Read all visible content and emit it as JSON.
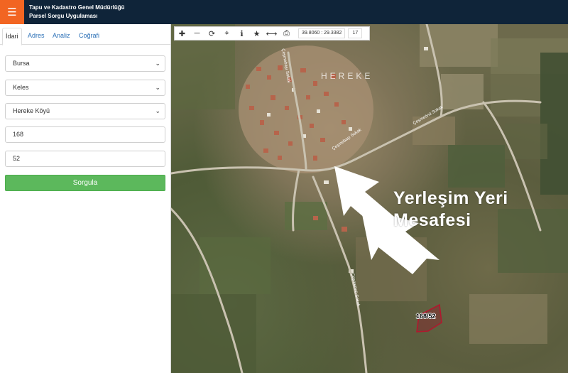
{
  "header": {
    "menu_icon": "hamburger-icon",
    "title_line1": "Tapu ve Kadastro Genel Müdürlüğü",
    "title_line2": "Parsel Sorgu Uygulaması",
    "background": "#0f2439",
    "accent": "#f26522"
  },
  "sidebar": {
    "tabs": [
      {
        "label": "İdari",
        "active": true
      },
      {
        "label": "Adres",
        "active": false
      },
      {
        "label": "Analiz",
        "active": false
      },
      {
        "label": "Coğrafi",
        "active": false
      }
    ],
    "province": "Bursa",
    "district": "Keles",
    "neighborhood": "Hereke Köyü",
    "block": "168",
    "parcel": "52",
    "submit_label": "Sorgula",
    "submit_color": "#5cb85c"
  },
  "map": {
    "toolbar": {
      "coordinates": "39.8060 : 29.3382",
      "zoom": "17",
      "icons": [
        "zoom-in-icon",
        "zoom-out-icon",
        "refresh-icon",
        "locate-icon",
        "info-icon",
        "star-icon",
        "measure-icon",
        "print-icon"
      ]
    },
    "village_label": "HEREKE",
    "annotation_line1": "Yerleşim Yeri",
    "annotation_line2": "Mesafesi",
    "parcel_label": "168/52",
    "road_labels": [
      "Çeşmebaşı Sokak",
      "Çeşmebaşı Sokak",
      "Çeşmeönü Sokak",
      "Çeşmeönü Sokak"
    ]
  }
}
